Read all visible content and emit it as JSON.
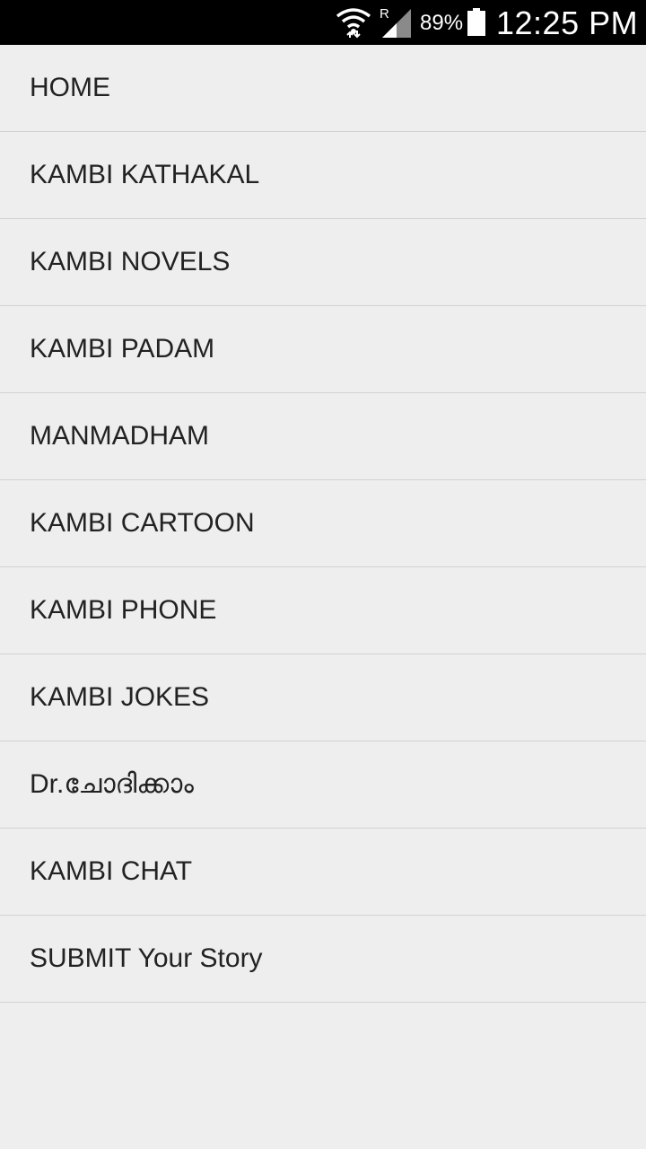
{
  "status_bar": {
    "battery_percent": "89%",
    "time": "12:25 PM",
    "network_label": "R",
    "icons": [
      "wifi-icon",
      "signal-icon",
      "battery-icon"
    ]
  },
  "menu": {
    "items": [
      {
        "label": "HOME"
      },
      {
        "label": "KAMBI KATHAKAL"
      },
      {
        "label": "KAMBI NOVELS"
      },
      {
        "label": "KAMBI PADAM"
      },
      {
        "label": "MANMADHAM"
      },
      {
        "label": "KAMBI CARTOON"
      },
      {
        "label": "KAMBI PHONE"
      },
      {
        "label": "KAMBI JOKES"
      },
      {
        "label": "Dr.ചോദിക്കാം"
      },
      {
        "label": "KAMBI CHAT"
      },
      {
        "label": "SUBMIT Your Story"
      }
    ]
  },
  "colors": {
    "background": "#eeeeee",
    "divider": "#d2d2d2",
    "text": "#222222",
    "status_bar": "#000000"
  }
}
